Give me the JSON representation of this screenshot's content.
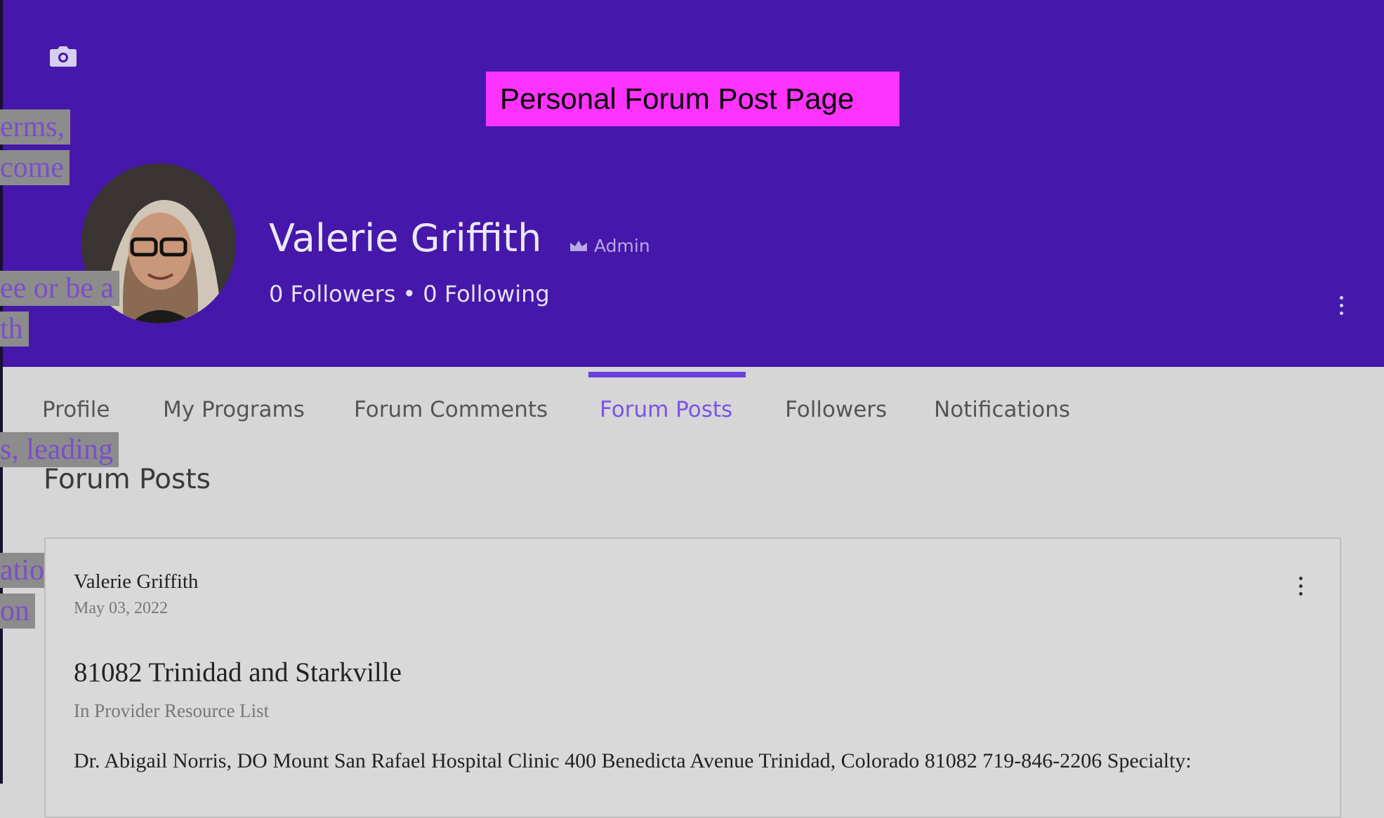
{
  "overlay_label": "Personal Forum Post Page",
  "profile": {
    "name": "Valerie Griffith",
    "badge": "Admin",
    "followers": "0 Followers",
    "separator": "•",
    "following": "0 Following"
  },
  "tabs": [
    {
      "label": "Profile",
      "active": false
    },
    {
      "label": "My Programs",
      "active": false
    },
    {
      "label": "Forum Comments",
      "active": false
    },
    {
      "label": "Forum Posts",
      "active": true
    },
    {
      "label": "Followers",
      "active": false
    },
    {
      "label": "Notifications",
      "active": false
    }
  ],
  "section_title": "Forum Posts",
  "post": {
    "author": "Valerie Griffith",
    "date": "May 03, 2022",
    "title": "81082 Trinidad and Starkville",
    "category": "In Provider Resource List",
    "body": "Dr. Abigail Norris, DO Mount San Rafael Hospital Clinic 400 Benedicta Avenue Trinidad, Colorado 81082 719-846-2206 Specialty:"
  },
  "left_snippets": [
    "erms,",
    "come",
    "ee or be a",
    "th",
    "s, leading",
    "ation",
    "on"
  ],
  "icons": {
    "camera": "camera-icon",
    "crown": "crown-icon",
    "header_menu": "more-vertical-icon",
    "post_menu": "more-vertical-icon"
  },
  "colors": {
    "header_bg": "#4517aa",
    "accent": "#7a52ea",
    "overlay_bg": "#ff33ff",
    "page_bg": "#d6d6d6"
  }
}
